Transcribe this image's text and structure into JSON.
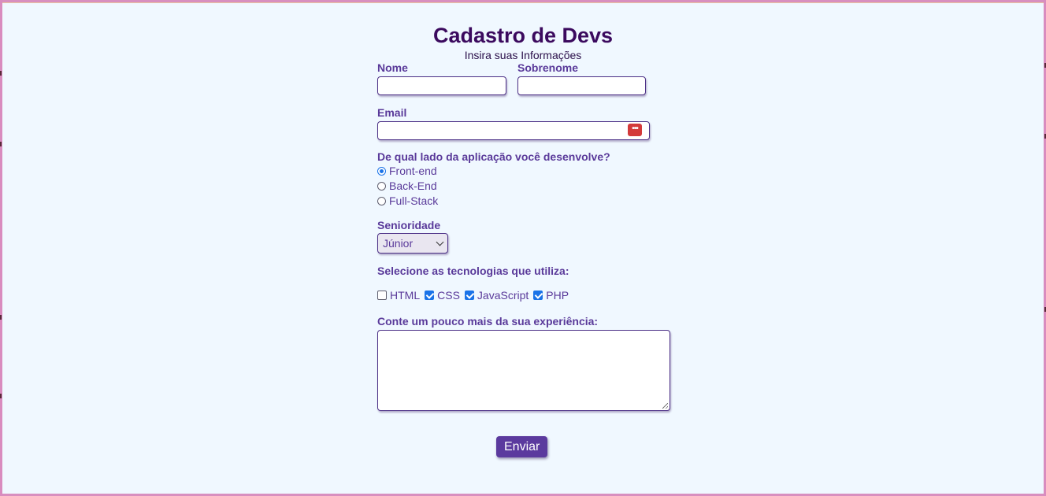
{
  "header": {
    "title": "Cadastro de Devs",
    "subtitle": "Insira suas Informações"
  },
  "form": {
    "nome_label": "Nome",
    "nome_value": "",
    "sobrenome_label": "Sobrenome",
    "sobrenome_value": "",
    "email_label": "Email",
    "email_value": "",
    "password_manager_glyph": "•••",
    "side_question": "De qual lado da aplicação você desenvolve?",
    "side_options": [
      {
        "label": "Front-end",
        "checked": true
      },
      {
        "label": "Back-End",
        "checked": false
      },
      {
        "label": "Full-Stack",
        "checked": false
      }
    ],
    "seniority_label": "Senioridade",
    "seniority_selected": "Júnior",
    "tech_label": "Selecione as tecnologias que utiliza:",
    "tech_options": [
      {
        "label": "HTML",
        "checked": false
      },
      {
        "label": "CSS",
        "checked": true
      },
      {
        "label": "JavaScript",
        "checked": true
      },
      {
        "label": "PHP",
        "checked": true
      }
    ],
    "experience_label": "Conte um pouco mais da sua experiência:",
    "experience_value": "",
    "submit_label": "Enviar"
  },
  "colors": {
    "background": "#f0f8ff",
    "title": "#3b0a5e",
    "label": "#5a3a9a",
    "button": "#5b3a9e",
    "frame": "#d88fbf"
  },
  "icons": {
    "password_manager": "password-manager-icon",
    "select_arrow": "chevron-down-icon",
    "resize": "resize-grip-icon"
  }
}
